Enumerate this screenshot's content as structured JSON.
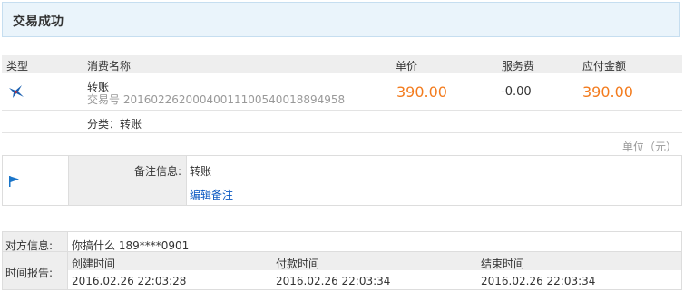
{
  "page": {
    "title": "交易成功"
  },
  "table": {
    "headers": {
      "type": "类型",
      "name": "消费名称",
      "price": "单价",
      "fee": "服务费",
      "total": "应付金额"
    },
    "row": {
      "icon": "swallow-logo-icon",
      "name": "转账",
      "trade_no_label": "交易号",
      "trade_no": "20160226200040011100540018894958",
      "price": "390.00",
      "fee": "-0.00",
      "total": "390.00",
      "category_label": "分类：",
      "category": "转账"
    },
    "unit": "单位（元）"
  },
  "remark": {
    "icon": "flag-icon",
    "label": "备注信息:",
    "value": "转账",
    "edit_link": "编辑备注"
  },
  "info": {
    "counterparty_label": "对方信息:",
    "counterparty": "你搞什么 189****0901",
    "time_label": "时间报告:",
    "time_headers": [
      "创建时间",
      "付款时间",
      "结束时间"
    ],
    "time_values": [
      "2016.02.26 22:03:28",
      "2016.02.26 22:03:34",
      "2016.02.26 22:03:34"
    ]
  },
  "colors": {
    "amount": "#f37b1d",
    "header_bg": "#eaf4fb",
    "link": "#0a58c2"
  }
}
